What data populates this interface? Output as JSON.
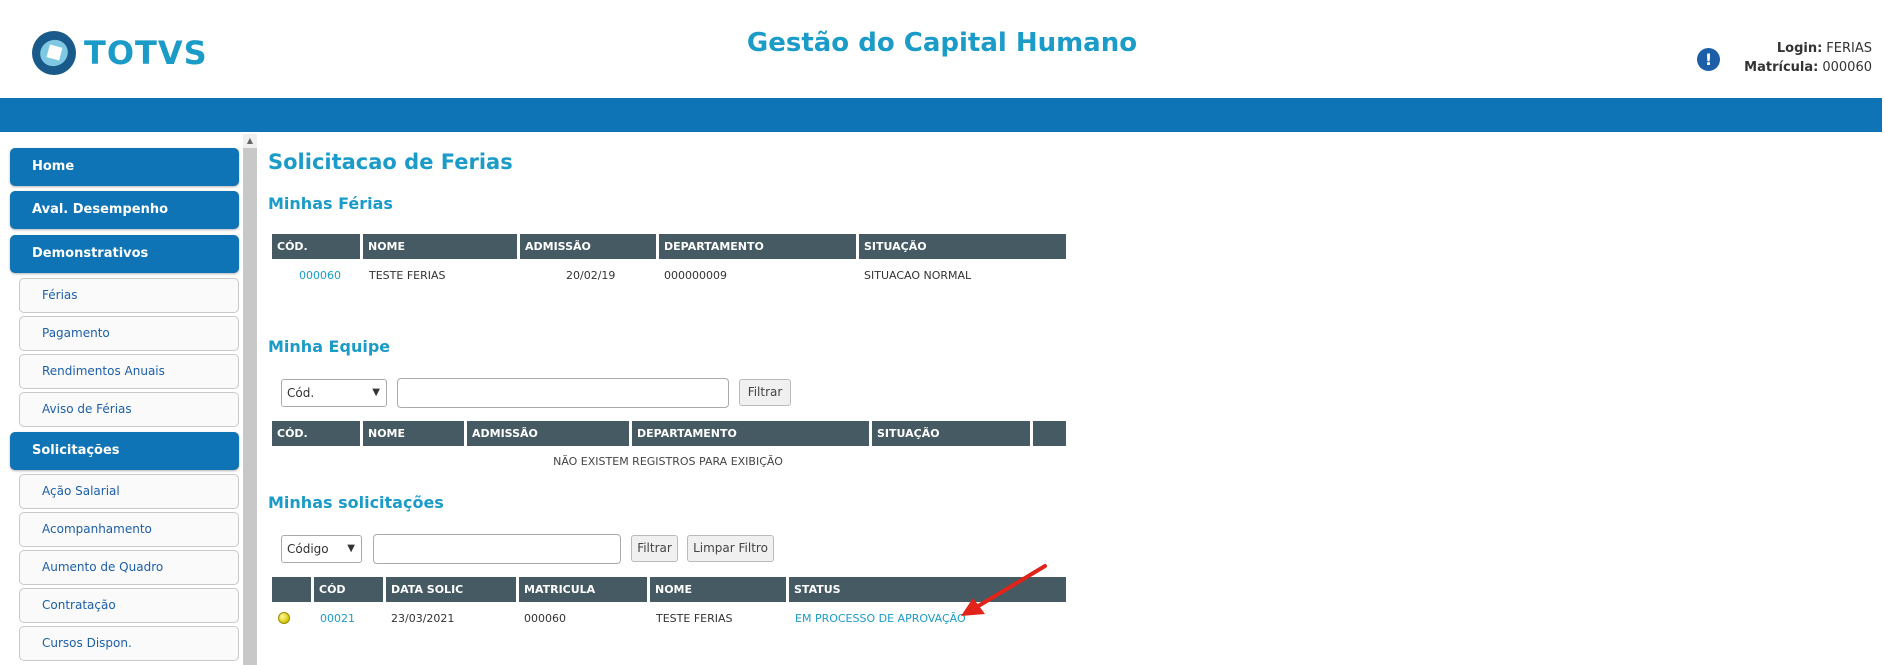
{
  "header": {
    "logo_text": "TOTVS",
    "app_title": "Gestão do Capital Humano",
    "alert_icon": "exclamation-icon",
    "login_label": "Login:",
    "login_value": "FERIAS",
    "matricula_label": "Matrícula:",
    "matricula_value": "000060"
  },
  "colors": {
    "accent": "#1b9bc8",
    "bar": "#0f74b5",
    "table_header": "#455a63",
    "status_pending": "#e3d200",
    "annotation_arrow": "#e2231a"
  },
  "sidebar": {
    "items": [
      {
        "label": "Home",
        "type": "main"
      },
      {
        "label": "Aval. Desempenho",
        "type": "main"
      },
      {
        "label": "Demonstrativos",
        "type": "main"
      },
      {
        "label": "Férias",
        "type": "sub"
      },
      {
        "label": "Pagamento",
        "type": "sub"
      },
      {
        "label": "Rendimentos Anuais",
        "type": "sub"
      },
      {
        "label": "Aviso de Férias",
        "type": "sub"
      },
      {
        "label": "Solicitações",
        "type": "main"
      },
      {
        "label": "Ação Salarial",
        "type": "sub"
      },
      {
        "label": "Acompanhamento",
        "type": "sub"
      },
      {
        "label": "Aumento de Quadro",
        "type": "sub"
      },
      {
        "label": "Contratação",
        "type": "sub"
      },
      {
        "label": "Cursos Dispon.",
        "type": "sub"
      }
    ]
  },
  "main": {
    "page_title": "Solicitacao de Ferias",
    "minhas_ferias": {
      "title": "Minhas Férias",
      "columns": [
        "CÓD.",
        "NOME",
        "ADMISSÃO",
        "DEPARTAMENTO",
        "SITUAÇÃO"
      ],
      "rows": [
        {
          "cod": "000060",
          "nome": "TESTE FERIAS",
          "admissao": "20/02/19",
          "departamento": "000000009",
          "situacao": "SITUACAO NORMAL"
        }
      ]
    },
    "minha_equipe": {
      "title": "Minha Equipe",
      "filter_select": "Cód.",
      "filter_input": "",
      "filter_button": "Filtrar",
      "columns": [
        "CÓD.",
        "NOME",
        "ADMISSÃO",
        "DEPARTAMENTO",
        "SITUAÇÃO",
        ""
      ],
      "empty_message": "NÃO EXISTEM REGISTROS PARA EXIBIÇÃO"
    },
    "minhas_solicitacoes": {
      "title": "Minhas solicitações",
      "filter_select": "Código",
      "filter_input": "",
      "filter_button": "Filtrar",
      "clear_button": "Limpar Filtro",
      "columns": [
        "",
        "CÓD",
        "DATA SOLIC",
        "MATRICULA",
        "NOME",
        "STATUS"
      ],
      "rows": [
        {
          "cod": "00021",
          "data_solic": "23/03/2021",
          "matricula": "000060",
          "nome": "TESTE FERIAS",
          "status": "EM PROCESSO DE APROVAÇÃO"
        }
      ]
    }
  }
}
